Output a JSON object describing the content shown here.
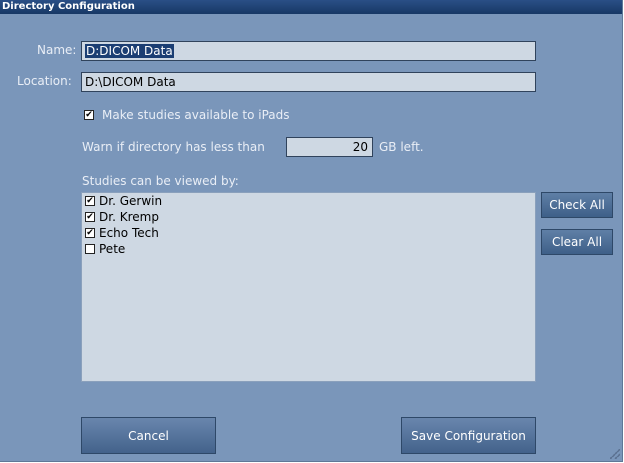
{
  "window": {
    "title": "Directory Configuration"
  },
  "form": {
    "name_label": "Name:",
    "name_value": "D:DICOM Data",
    "location_label": "Location:",
    "location_value": "D:\\DICOM Data",
    "ipad_checked": true,
    "ipad_label": "Make studies available to iPads",
    "warn_label": "Warn if directory has less than",
    "warn_value": "20",
    "warn_unit": "GB left.",
    "studies_label": "Studies can be viewed by:"
  },
  "viewers": [
    {
      "name": "Dr. Gerwin",
      "checked": true
    },
    {
      "name": "Dr. Kremp",
      "checked": true
    },
    {
      "name": "Echo Tech",
      "checked": true
    },
    {
      "name": "Pete",
      "checked": false
    }
  ],
  "buttons": {
    "check_all": "Check All",
    "clear_all": "Clear All",
    "cancel": "Cancel",
    "save": "Save Configuration"
  },
  "colors": {
    "window_bg": "#7a96ba",
    "titlebar": "#1f4375",
    "field_bg": "#ced8e3",
    "selection": "#1b3e73"
  }
}
